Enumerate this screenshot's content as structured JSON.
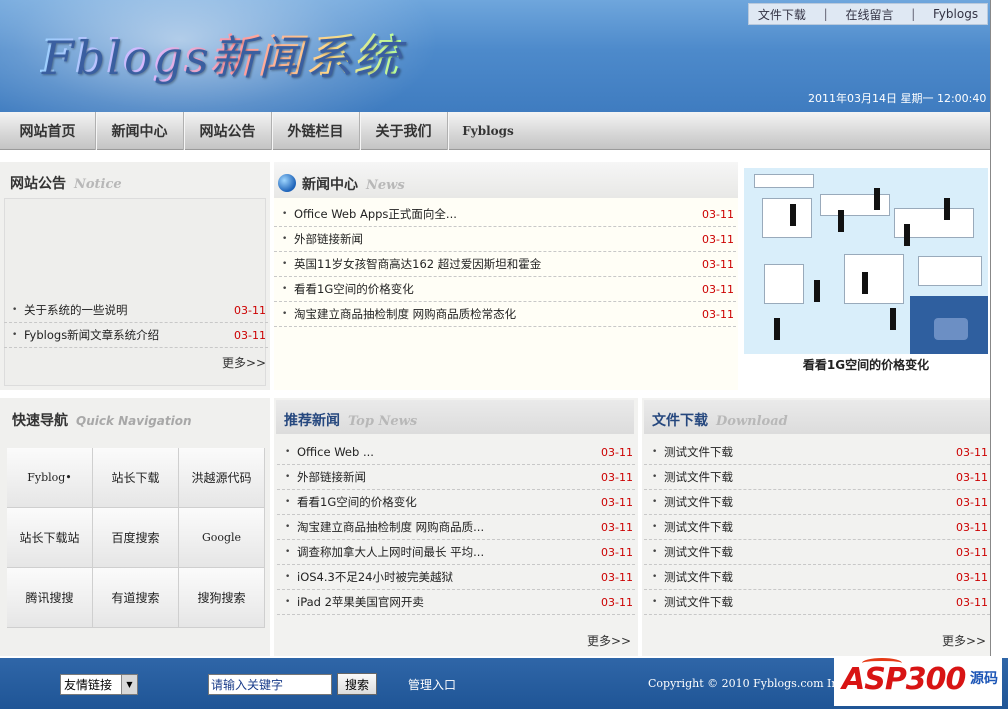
{
  "header": {
    "logo_text": "Fblogs新闻系统",
    "top_links": [
      "文件下载",
      "在线留言",
      "Fyblogs"
    ],
    "datetime": "2011年03月14日 星期一 12:00:40"
  },
  "nav": {
    "items": [
      "网站首页",
      "新闻中心",
      "网站公告",
      "外链栏目",
      "关于我们",
      "Fyblogs"
    ]
  },
  "notice": {
    "title": "网站公告",
    "title_en": "Notice",
    "items": [
      {
        "text": "关于系统的一些说明",
        "date": "03-11"
      },
      {
        "text": "Fyblogs新闻文章系统介绍",
        "date": "03-11"
      }
    ],
    "more": "更多>>"
  },
  "news_center": {
    "title": "新闻中心",
    "title_en": "News",
    "items": [
      {
        "text": "Office Web Apps正式面向全...",
        "date": "03-11"
      },
      {
        "text": "外部链接新闻",
        "date": "03-11"
      },
      {
        "text": "英国11岁女孩智商高达162 超过爱因斯坦和霍金",
        "date": "03-11"
      },
      {
        "text": "看看1G空间的价格变化",
        "date": "03-11"
      },
      {
        "text": "淘宝建立商品抽检制度 网购商品质检常态化",
        "date": "03-11"
      }
    ],
    "photo_caption": "看看1G空间的价格变化"
  },
  "quick_nav": {
    "title": "快速导航",
    "title_en": "Quick Navigation",
    "links": [
      "Fyblog•",
      "站长下载",
      "洪越源代码",
      "站长下载站",
      "百度搜索",
      "Google",
      "腾讯搜搜",
      "有道搜索",
      "搜狗搜索"
    ]
  },
  "top_news": {
    "title": "推荐新闻",
    "title_en": "Top News",
    "items": [
      {
        "text": "Office Web ...",
        "date": "03-11"
      },
      {
        "text": "外部链接新闻",
        "date": "03-11"
      },
      {
        "text": "看看1G空间的价格变化",
        "date": "03-11"
      },
      {
        "text": "淘宝建立商品抽检制度 网购商品质...",
        "date": "03-11"
      },
      {
        "text": "调查称加拿大人上网时间最长 平均...",
        "date": "03-11"
      },
      {
        "text": "iOS4.3不足24小时被完美越狱",
        "date": "03-11"
      },
      {
        "text": "iPad 2苹果美国官网开卖",
        "date": "03-11"
      }
    ],
    "more": "更多>>"
  },
  "download": {
    "title": "文件下载",
    "title_en": "Download",
    "items": [
      {
        "text": "测试文件下载",
        "date": "03-11"
      },
      {
        "text": "测试文件下载",
        "date": "03-11"
      },
      {
        "text": "测试文件下载",
        "date": "03-11"
      },
      {
        "text": "测试文件下载",
        "date": "03-11"
      },
      {
        "text": "测试文件下载",
        "date": "03-11"
      },
      {
        "text": "测试文件下载",
        "date": "03-11"
      },
      {
        "text": "测试文件下载",
        "date": "03-11"
      }
    ],
    "more": "更多>>"
  },
  "footer": {
    "links_select": "友情链接",
    "search_placeholder": "请输入关键字",
    "search_button": "搜索",
    "admin": "管理入口",
    "copyright": "Copyright © 2010 Fyblogs.com Inc",
    "watermark": "ASP300",
    "watermark_sub": "源码"
  },
  "colors": {
    "header_blue": "#4d8acb",
    "date_red": "#cc0000",
    "footer_blue": "#2f66a8"
  }
}
